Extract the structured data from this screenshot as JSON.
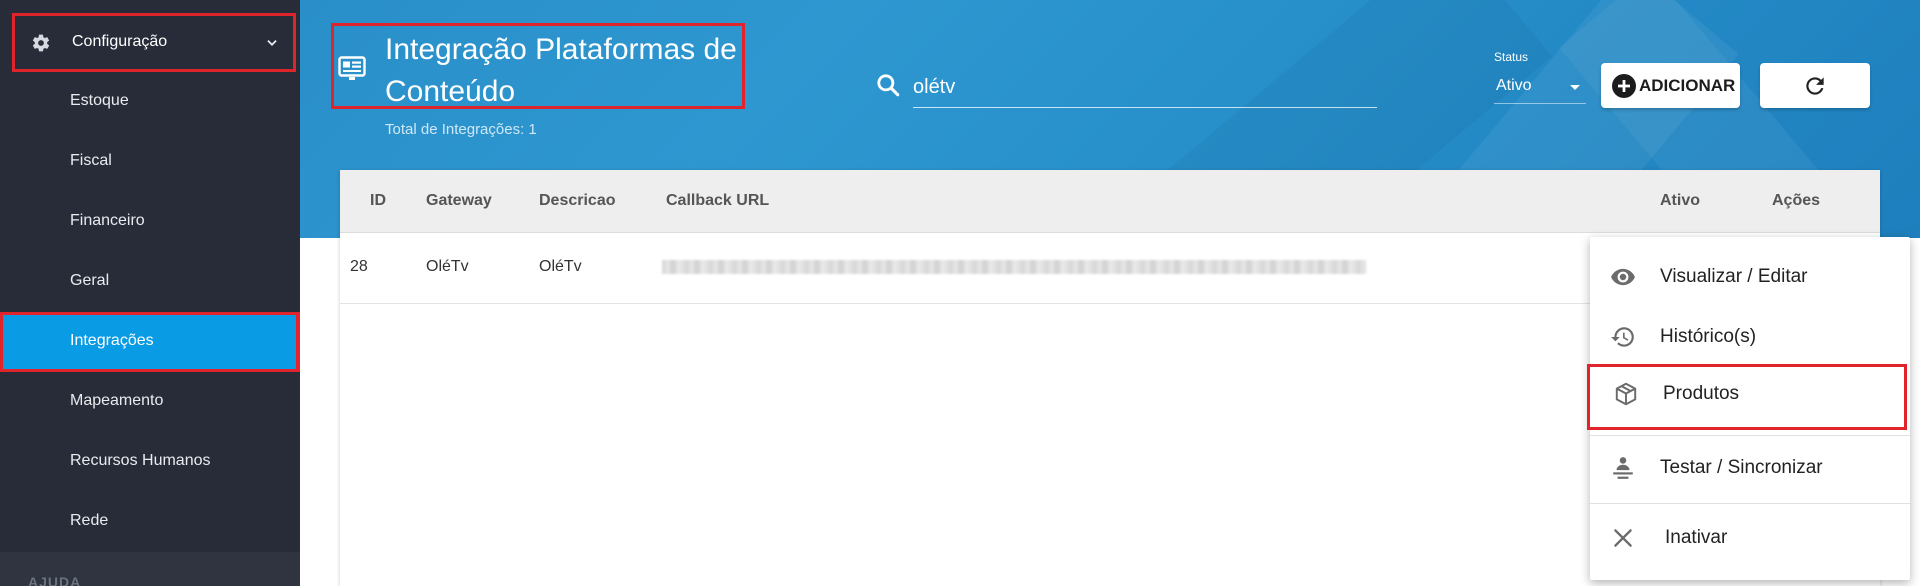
{
  "sidebar": {
    "config_label": "Configuração",
    "items": [
      {
        "label": "Estoque"
      },
      {
        "label": "Fiscal"
      },
      {
        "label": "Financeiro"
      },
      {
        "label": "Geral"
      },
      {
        "label": "Integrações"
      },
      {
        "label": "Mapeamento"
      },
      {
        "label": "Recursos Humanos"
      },
      {
        "label": "Rede"
      }
    ],
    "active_item": "Integrações",
    "section_label": "AJUDA"
  },
  "header": {
    "title": "Integração Plataformas de Conteúdo",
    "total": "Total de Integrações: 1",
    "search_value": "olétv",
    "status_label": "Status",
    "status_value": "Ativo",
    "add_label": "ADICIONAR"
  },
  "table": {
    "columns": [
      "ID",
      "Gateway",
      "Descricao",
      "Callback URL",
      "Ativo",
      "Ações"
    ],
    "rows": [
      {
        "id": "28",
        "gateway": "OléTv",
        "descricao": "OléTv"
      }
    ]
  },
  "menu": {
    "items": [
      {
        "label": "Visualizar / Editar",
        "icon": "eye-icon"
      },
      {
        "label": "Histórico(s)",
        "icon": "history-icon"
      },
      {
        "label": "Produtos",
        "icon": "box-icon"
      },
      {
        "label": "Testar / Sincronizar",
        "icon": "sync-user-icon"
      },
      {
        "label": "Inativar",
        "icon": "close-icon"
      }
    ]
  },
  "colors": {
    "sidebar_bg": "#272c38",
    "active_item": "#0a9be5",
    "header_bg": "#2a8fc9",
    "highlight_border": "#e0242b"
  }
}
